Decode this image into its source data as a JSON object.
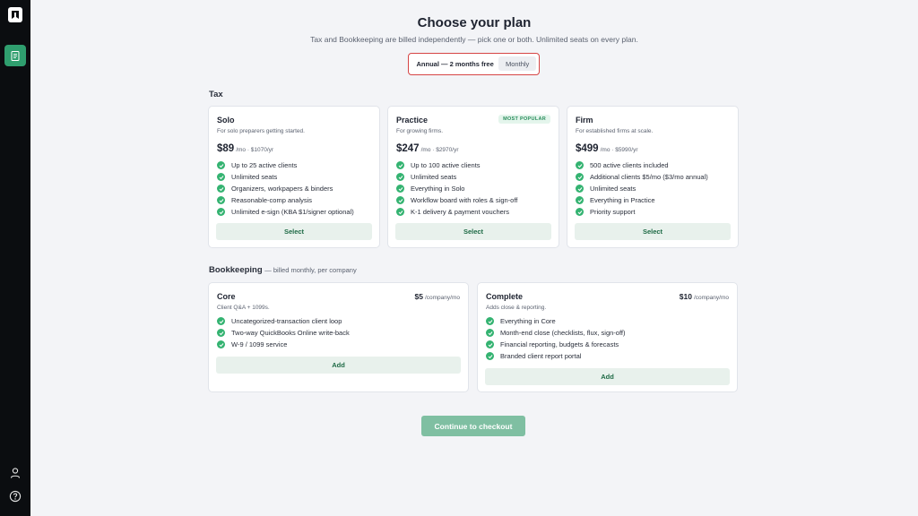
{
  "header": {
    "title": "Choose your plan",
    "subtitle": "Tax and Bookkeeping are billed independently — pick one or both. Unlimited seats on every plan."
  },
  "billing_toggle": {
    "annual_label": "Annual — 2 months free",
    "monthly_label": "Monthly",
    "selected": "annual"
  },
  "tax": {
    "section_label": "Tax",
    "plans": [
      {
        "name": "Solo",
        "desc": "For solo preparers getting started.",
        "price": "$89",
        "price_unit": "/mo · $1070/yr",
        "features": [
          "Up to 25 active clients",
          "Unlimited seats",
          "Organizers, workpapers & binders",
          "Reasonable-comp analysis",
          "Unlimited e-sign (KBA $1/signer optional)"
        ],
        "button": "Select"
      },
      {
        "name": "Practice",
        "badge": "MOST POPULAR",
        "desc": "For growing firms.",
        "price": "$247",
        "price_unit": "/mo · $2970/yr",
        "features": [
          "Up to 100 active clients",
          "Unlimited seats",
          "Everything in Solo",
          "Workflow board with roles & sign-off",
          "K-1 delivery & payment vouchers"
        ],
        "button": "Select"
      },
      {
        "name": "Firm",
        "desc": "For established firms at scale.",
        "price": "$499",
        "price_unit": "/mo · $5990/yr",
        "features": [
          "500 active clients included",
          "Additional clients $5/mo ($3/mo annual)",
          "Unlimited seats",
          "Everything in Practice",
          "Priority support"
        ],
        "button": "Select"
      }
    ]
  },
  "bookkeeping": {
    "section_label": "Bookkeeping",
    "section_note": "— billed monthly, per company",
    "plans": [
      {
        "name": "Core",
        "desc": "Client Q&A + 1099s.",
        "price": "$5",
        "price_unit": "/company/mo",
        "features": [
          "Uncategorized-transaction client loop",
          "Two-way QuickBooks Online write-back",
          "W-9 / 1099 service"
        ],
        "button": "Add"
      },
      {
        "name": "Complete",
        "desc": "Adds close & reporting.",
        "price": "$10",
        "price_unit": "/company/mo",
        "features": [
          "Everything in Core",
          "Month-end close (checklists, flux, sign-off)",
          "Financial reporting, budgets & forecasts",
          "Branded client report portal"
        ],
        "button": "Add"
      }
    ]
  },
  "checkout_button": "Continue to checkout",
  "sidebar": {
    "icons": [
      "logo-icon",
      "document-icon",
      "user-icon",
      "help-icon"
    ]
  },
  "colors": {
    "accent": "#2f9e6e",
    "check": "#34b371",
    "toggle_highlight": "#d64545",
    "checkout": "#7fbfa2"
  }
}
